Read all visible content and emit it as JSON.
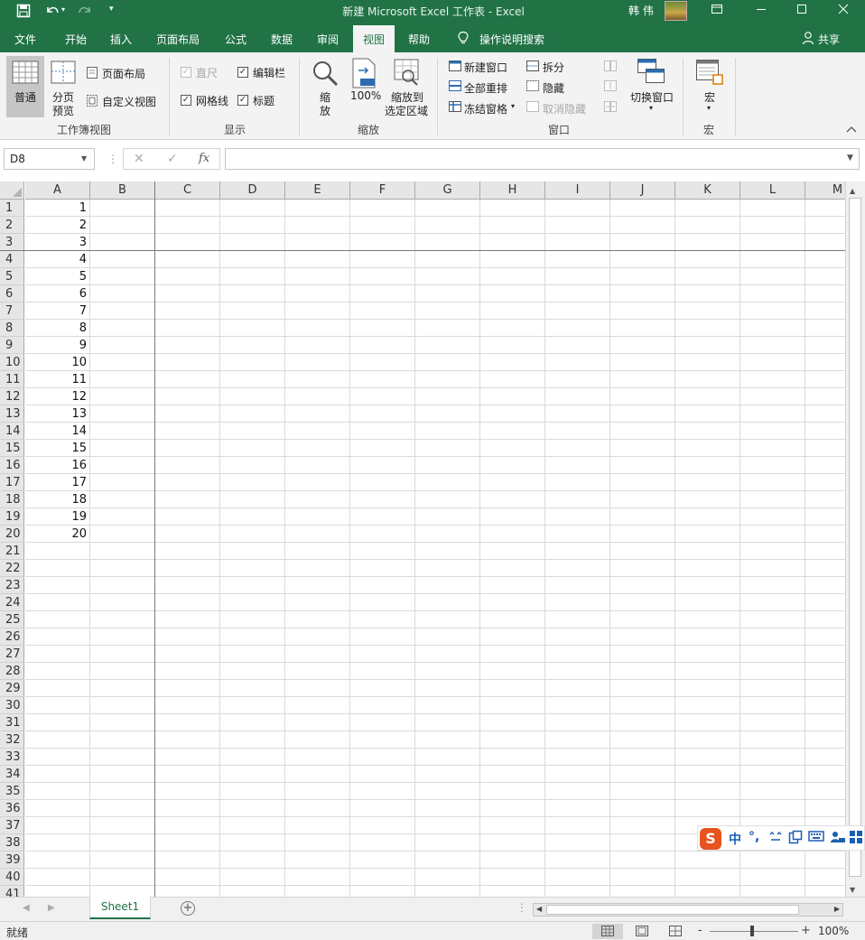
{
  "window": {
    "title": "新建 Microsoft Excel 工作表  -  Excel",
    "user": "韩 伟",
    "accent_color": "#217346"
  },
  "quick_access": {
    "save_icon": "save-icon",
    "undo_icon": "undo-icon",
    "redo_icon": "redo-icon",
    "customize_icon": "chevron-down-icon"
  },
  "ribbon_tabs": {
    "file": "文件",
    "home": "开始",
    "insert": "插入",
    "page_layout": "页面布局",
    "formulas": "公式",
    "data": "数据",
    "review": "审阅",
    "view": "视图",
    "help": "帮助",
    "tell_me": "操作说明搜索",
    "share": "共享",
    "active": "视图"
  },
  "ribbon": {
    "workbook_views": {
      "label": "工作簿视图",
      "normal": "普通",
      "page_break_line1": "分页",
      "page_break_line2": "预览",
      "page_layout": "页面布局",
      "custom_views": "自定义视图"
    },
    "show": {
      "label": "显示",
      "ruler": "直尺",
      "formula_bar": "编辑栏",
      "gridlines": "网格线",
      "headings": "标题"
    },
    "zoom": {
      "label": "缩放",
      "zoom_line1": "缩",
      "zoom_line2": "放",
      "zoom_100": "100%",
      "zoom_sel_line1": "缩放到",
      "zoom_sel_line2": "选定区域"
    },
    "window": {
      "label": "窗口",
      "new_window": "新建窗口",
      "arrange_all": "全部重排",
      "freeze_panes": "冻结窗格",
      "split": "拆分",
      "hide": "隐藏",
      "unhide": "取消隐藏",
      "switch_windows": "切换窗口"
    },
    "macros": {
      "label": "宏",
      "macros": "宏"
    }
  },
  "formula_bar": {
    "name_box": "D8",
    "formula": ""
  },
  "sheet": {
    "columns": [
      "A",
      "B",
      "C",
      "D",
      "E",
      "F",
      "G",
      "H",
      "I",
      "J",
      "K",
      "L",
      "M"
    ],
    "rows": [
      "1",
      "2",
      "3",
      "4",
      "5",
      "6",
      "7",
      "8",
      "9",
      "10",
      "11",
      "12",
      "13",
      "14",
      "15",
      "16",
      "17",
      "18",
      "19",
      "20",
      "21",
      "22",
      "23",
      "24",
      "25",
      "26",
      "27",
      "28",
      "29",
      "30",
      "31",
      "32",
      "33",
      "34",
      "35",
      "36",
      "37",
      "38",
      "39",
      "40",
      "41"
    ],
    "column_a_values": [
      "1",
      "2",
      "3",
      "4",
      "5",
      "6",
      "7",
      "8",
      "9",
      "10",
      "11",
      "12",
      "13",
      "14",
      "15",
      "16",
      "17",
      "18",
      "19",
      "20"
    ]
  },
  "sheet_tabs": {
    "active": "Sheet1"
  },
  "status_bar": {
    "ready": "就绪",
    "zoom": "100%"
  },
  "ime": {
    "chinese": "中",
    "punct": "°,"
  }
}
